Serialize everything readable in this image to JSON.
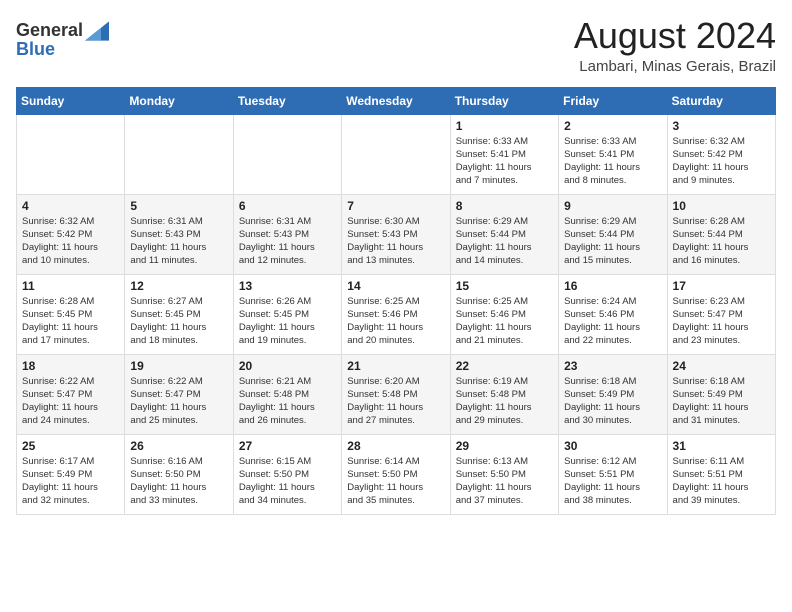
{
  "logo": {
    "general": "General",
    "blue": "Blue"
  },
  "title": {
    "month_year": "August 2024",
    "location": "Lambari, Minas Gerais, Brazil"
  },
  "calendar": {
    "headers": [
      "Sunday",
      "Monday",
      "Tuesday",
      "Wednesday",
      "Thursday",
      "Friday",
      "Saturday"
    ],
    "weeks": [
      [
        {
          "day": "",
          "info": ""
        },
        {
          "day": "",
          "info": ""
        },
        {
          "day": "",
          "info": ""
        },
        {
          "day": "",
          "info": ""
        },
        {
          "day": "1",
          "info": "Sunrise: 6:33 AM\nSunset: 5:41 PM\nDaylight: 11 hours\nand 7 minutes."
        },
        {
          "day": "2",
          "info": "Sunrise: 6:33 AM\nSunset: 5:41 PM\nDaylight: 11 hours\nand 8 minutes."
        },
        {
          "day": "3",
          "info": "Sunrise: 6:32 AM\nSunset: 5:42 PM\nDaylight: 11 hours\nand 9 minutes."
        }
      ],
      [
        {
          "day": "4",
          "info": "Sunrise: 6:32 AM\nSunset: 5:42 PM\nDaylight: 11 hours\nand 10 minutes."
        },
        {
          "day": "5",
          "info": "Sunrise: 6:31 AM\nSunset: 5:43 PM\nDaylight: 11 hours\nand 11 minutes."
        },
        {
          "day": "6",
          "info": "Sunrise: 6:31 AM\nSunset: 5:43 PM\nDaylight: 11 hours\nand 12 minutes."
        },
        {
          "day": "7",
          "info": "Sunrise: 6:30 AM\nSunset: 5:43 PM\nDaylight: 11 hours\nand 13 minutes."
        },
        {
          "day": "8",
          "info": "Sunrise: 6:29 AM\nSunset: 5:44 PM\nDaylight: 11 hours\nand 14 minutes."
        },
        {
          "day": "9",
          "info": "Sunrise: 6:29 AM\nSunset: 5:44 PM\nDaylight: 11 hours\nand 15 minutes."
        },
        {
          "day": "10",
          "info": "Sunrise: 6:28 AM\nSunset: 5:44 PM\nDaylight: 11 hours\nand 16 minutes."
        }
      ],
      [
        {
          "day": "11",
          "info": "Sunrise: 6:28 AM\nSunset: 5:45 PM\nDaylight: 11 hours\nand 17 minutes."
        },
        {
          "day": "12",
          "info": "Sunrise: 6:27 AM\nSunset: 5:45 PM\nDaylight: 11 hours\nand 18 minutes."
        },
        {
          "day": "13",
          "info": "Sunrise: 6:26 AM\nSunset: 5:45 PM\nDaylight: 11 hours\nand 19 minutes."
        },
        {
          "day": "14",
          "info": "Sunrise: 6:25 AM\nSunset: 5:46 PM\nDaylight: 11 hours\nand 20 minutes."
        },
        {
          "day": "15",
          "info": "Sunrise: 6:25 AM\nSunset: 5:46 PM\nDaylight: 11 hours\nand 21 minutes."
        },
        {
          "day": "16",
          "info": "Sunrise: 6:24 AM\nSunset: 5:46 PM\nDaylight: 11 hours\nand 22 minutes."
        },
        {
          "day": "17",
          "info": "Sunrise: 6:23 AM\nSunset: 5:47 PM\nDaylight: 11 hours\nand 23 minutes."
        }
      ],
      [
        {
          "day": "18",
          "info": "Sunrise: 6:22 AM\nSunset: 5:47 PM\nDaylight: 11 hours\nand 24 minutes."
        },
        {
          "day": "19",
          "info": "Sunrise: 6:22 AM\nSunset: 5:47 PM\nDaylight: 11 hours\nand 25 minutes."
        },
        {
          "day": "20",
          "info": "Sunrise: 6:21 AM\nSunset: 5:48 PM\nDaylight: 11 hours\nand 26 minutes."
        },
        {
          "day": "21",
          "info": "Sunrise: 6:20 AM\nSunset: 5:48 PM\nDaylight: 11 hours\nand 27 minutes."
        },
        {
          "day": "22",
          "info": "Sunrise: 6:19 AM\nSunset: 5:48 PM\nDaylight: 11 hours\nand 29 minutes."
        },
        {
          "day": "23",
          "info": "Sunrise: 6:18 AM\nSunset: 5:49 PM\nDaylight: 11 hours\nand 30 minutes."
        },
        {
          "day": "24",
          "info": "Sunrise: 6:18 AM\nSunset: 5:49 PM\nDaylight: 11 hours\nand 31 minutes."
        }
      ],
      [
        {
          "day": "25",
          "info": "Sunrise: 6:17 AM\nSunset: 5:49 PM\nDaylight: 11 hours\nand 32 minutes."
        },
        {
          "day": "26",
          "info": "Sunrise: 6:16 AM\nSunset: 5:50 PM\nDaylight: 11 hours\nand 33 minutes."
        },
        {
          "day": "27",
          "info": "Sunrise: 6:15 AM\nSunset: 5:50 PM\nDaylight: 11 hours\nand 34 minutes."
        },
        {
          "day": "28",
          "info": "Sunrise: 6:14 AM\nSunset: 5:50 PM\nDaylight: 11 hours\nand 35 minutes."
        },
        {
          "day": "29",
          "info": "Sunrise: 6:13 AM\nSunset: 5:50 PM\nDaylight: 11 hours\nand 37 minutes."
        },
        {
          "day": "30",
          "info": "Sunrise: 6:12 AM\nSunset: 5:51 PM\nDaylight: 11 hours\nand 38 minutes."
        },
        {
          "day": "31",
          "info": "Sunrise: 6:11 AM\nSunset: 5:51 PM\nDaylight: 11 hours\nand 39 minutes."
        }
      ]
    ]
  }
}
